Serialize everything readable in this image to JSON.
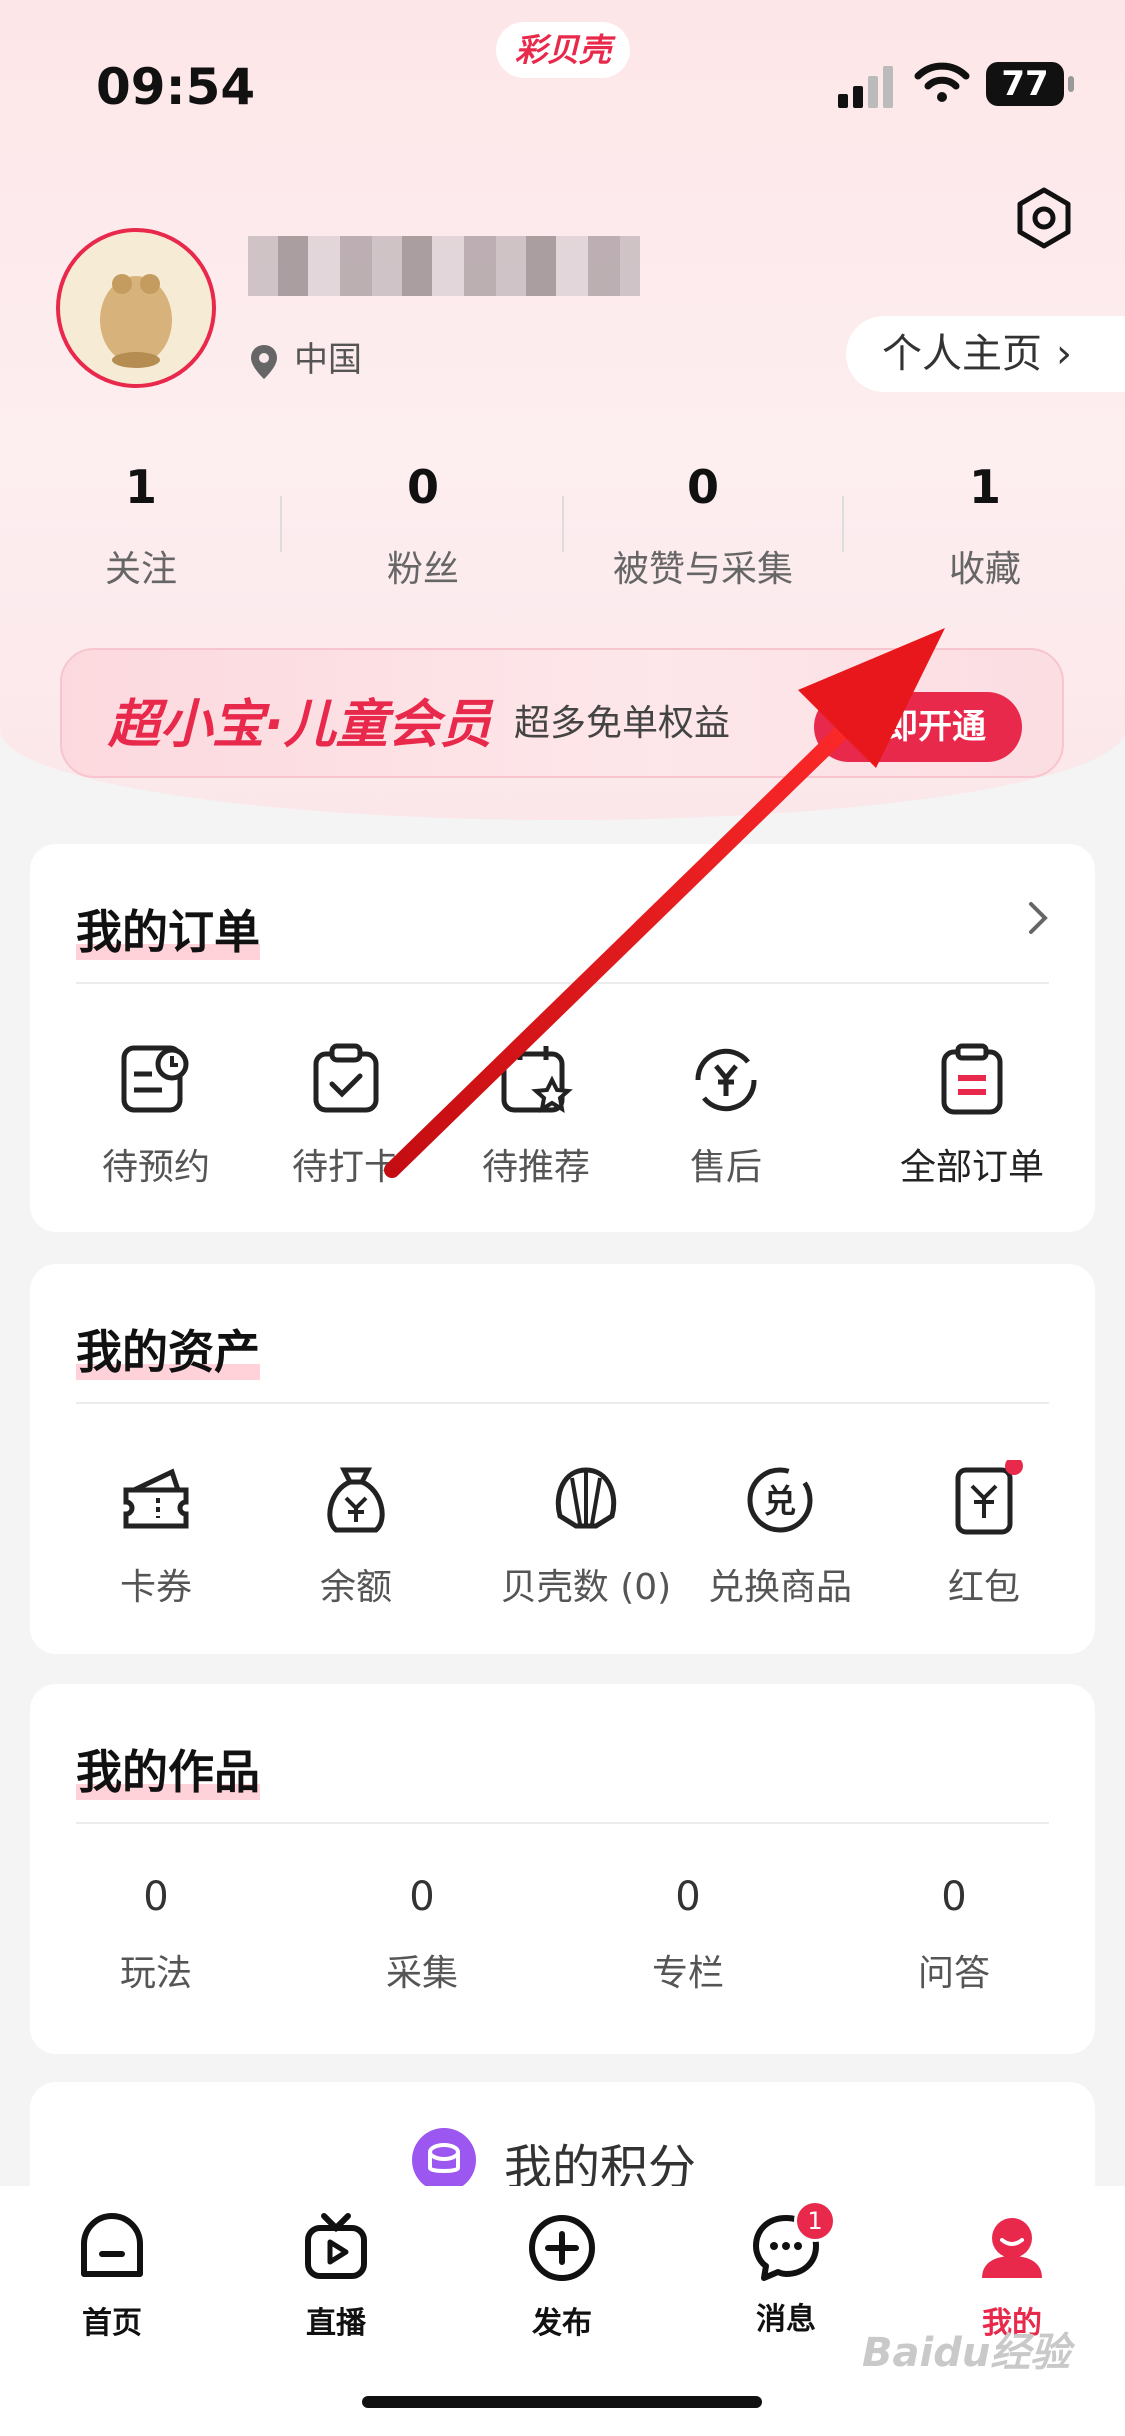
{
  "status_bar": {
    "time": "09:54",
    "battery": "77",
    "brand": "彩贝壳"
  },
  "profile": {
    "location": "中国",
    "home_button": "个人主页",
    "chevron": "›"
  },
  "stats": [
    {
      "value": "1",
      "label": "关注"
    },
    {
      "value": "0",
      "label": "粉丝"
    },
    {
      "value": "0",
      "label": "被赞与采集"
    },
    {
      "value": "1",
      "label": "收藏"
    }
  ],
  "vip": {
    "title": "超小宝·儿童会员",
    "subtitle": "超多免单权益",
    "button": "立即开通"
  },
  "orders": {
    "title": "我的订单",
    "items": [
      {
        "label": "待预约",
        "icon": "calendar-clock-icon"
      },
      {
        "label": "待打卡",
        "icon": "clipboard-check-icon"
      },
      {
        "label": "待推荐",
        "icon": "calendar-star-icon"
      },
      {
        "label": "售后",
        "icon": "yuan-refresh-icon"
      },
      {
        "label": "全部订单",
        "icon": "list-doc-icon"
      }
    ]
  },
  "assets": {
    "title": "我的资产",
    "items": [
      {
        "label": "卡券",
        "icon": "ticket-icon"
      },
      {
        "label": "余额",
        "icon": "money-bag-icon"
      },
      {
        "label": "贝壳数 (0)",
        "icon": "shell-icon"
      },
      {
        "label": "兑换商品",
        "icon": "exchange-icon"
      },
      {
        "label": "红包",
        "icon": "red-envelope-icon"
      }
    ]
  },
  "works": {
    "title": "我的作品",
    "items": [
      {
        "value": "0",
        "label": "玩法"
      },
      {
        "value": "0",
        "label": "采集"
      },
      {
        "value": "0",
        "label": "专栏"
      },
      {
        "value": "0",
        "label": "问答"
      }
    ]
  },
  "points": {
    "title": "我的积分"
  },
  "tabbar": [
    {
      "label": "首页",
      "icon": "home-icon"
    },
    {
      "label": "直播",
      "icon": "tv-play-icon"
    },
    {
      "label": "发布",
      "icon": "plus-circle-icon"
    },
    {
      "label": "消息",
      "icon": "chat-bubble-icon",
      "badge": "1"
    },
    {
      "label": "我的",
      "icon": "user-icon",
      "active": true
    }
  ],
  "watermark": "Baidu经验",
  "colors": {
    "accent": "#e8294b",
    "annotation_arrow": "#e8171b"
  }
}
